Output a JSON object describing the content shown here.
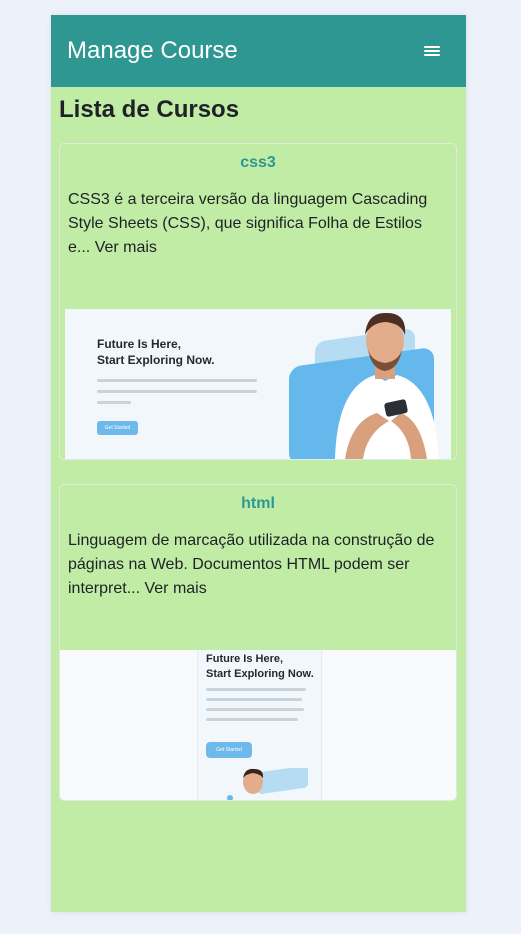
{
  "navbar": {
    "brand": "Manage Course",
    "menu_icon": "hamburger-menu-icon"
  },
  "page": {
    "title": "Lista de Cursos"
  },
  "courses": [
    {
      "title": "css3",
      "description": "CSS3 é a terceira versão da linguagem Cascading Style Sheets (CSS), que significa Folha de Estilos e...",
      "link": "Ver mais",
      "image": {
        "headline": [
          "Future Is Here,",
          "Start Exploring Now."
        ],
        "button": "Get Started"
      }
    },
    {
      "title": "html",
      "description": "Linguagem de marcação utilizada na construção de páginas na Web. Documentos HTML podem ser interpret...",
      "link": "Ver mais",
      "image": {
        "headline": [
          "Future Is Here,",
          "Start Exploring Now."
        ],
        "button": "Get Started"
      }
    }
  ],
  "colors": {
    "navbar": "#2e9792",
    "background": "#c1eca5",
    "accent_blue": "#65b8eb"
  }
}
